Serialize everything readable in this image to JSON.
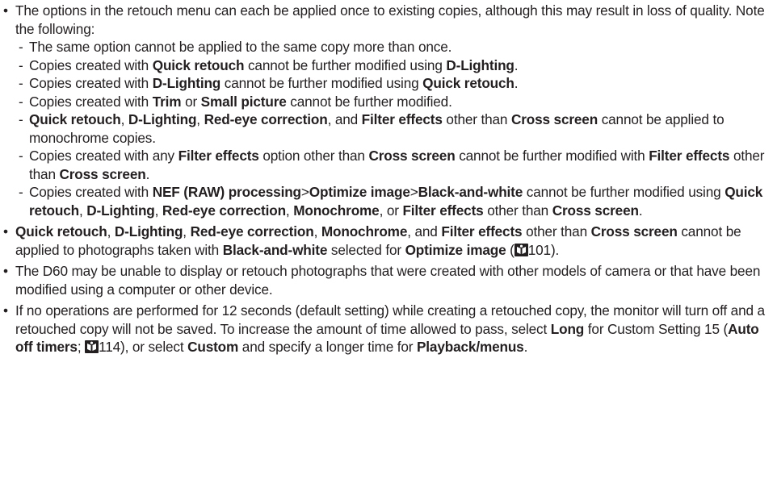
{
  "bullet_char": "•",
  "dash_char": "-",
  "b1": {
    "t1": "The options in the retouch menu can each be applied once to existing copies, although this may result in loss of quality. Note the following:",
    "subs": {
      "s1": {
        "t1": "The same option cannot be applied to the same copy more than once."
      },
      "s2": {
        "t1": "Copies created with ",
        "k1": "Quick retouch",
        "t2": " cannot be further modified using ",
        "k2": "D-Lighting",
        "t3": "."
      },
      "s3": {
        "t1": "Copies created with ",
        "k1": "D-Lighting",
        "t2": " cannot be further modified using ",
        "k2": "Quick retouch",
        "t3": "."
      },
      "s4": {
        "t1": "Copies created with ",
        "k1": "Trim",
        "t2": " or ",
        "k2": "Small picture",
        "t3": " cannot be further modified."
      },
      "s5": {
        "k1": "Quick retouch",
        "t1": ", ",
        "k2": "D-Lighting",
        "t2": ", ",
        "k3": "Red-eye correction",
        "t3": ", and ",
        "k4": "Filter effects",
        "t4": " other than ",
        "k5": "Cross screen",
        "t5": " cannot be applied to monochrome copies."
      },
      "s6": {
        "t1": "Copies created with any ",
        "k1": "Filter effects",
        "t2": " option other than ",
        "k2": "Cross screen",
        "t3": " cannot be further modified with ",
        "k3": "Filter effects",
        "t4": " other than ",
        "k4": "Cross screen",
        "t5": "."
      },
      "s7": {
        "t1": "Copies created with ",
        "k1": "NEF (RAW) processing",
        "t2": ">",
        "k2": "Optimize image",
        "t3": ">",
        "k3": "Black-and-white",
        "t4": " cannot be further modified using ",
        "k4": "Quick retouch",
        "t5": ", ",
        "k5": "D-Lighting",
        "t6": ", ",
        "k6": "Red-eye correction",
        "t7": ", ",
        "k7": "Monochrome",
        "t8": ", or ",
        "k8": "Filter effects",
        "t9": " other than ",
        "k9": "Cross screen",
        "t10": "."
      }
    }
  },
  "b2": {
    "k1": "Quick retouch",
    "t1": ", ",
    "k2": "D-Lighting",
    "t2": ", ",
    "k3": "Red-eye correction",
    "t3": ", ",
    "k4": "Monochrome",
    "t4": ", and ",
    "k5": "Filter effects",
    "t5": " other than ",
    "k6": "Cross screen",
    "t6": " cannot be applied to photographs taken with ",
    "k7": "Black-and-white",
    "t7": " selected for ",
    "k8": "Optimize image",
    "t8": " (",
    "ref": "101",
    "t9": ")."
  },
  "b3": {
    "t1": "The D60 may be unable to display or retouch photographs that were created with other models of camera or that have been modified using a computer or other device."
  },
  "b4": {
    "t1": "If no operations are performed for 12 seconds (default setting) while creating a retouched copy, the monitor will turn off and a retouched copy will not be saved. To increase the amount of time allowed to pass, select ",
    "k1": "Long",
    "t2": " for Custom Setting 15 (",
    "k2": "Auto off timers",
    "t3": "; ",
    "ref": "114",
    "t4": "), or select ",
    "k3": "Custom",
    "t5": " and specify a longer time for ",
    "k4": "Playback/menus",
    "t6": "."
  },
  "icons": {
    "page_ref": "page-reference-icon"
  }
}
